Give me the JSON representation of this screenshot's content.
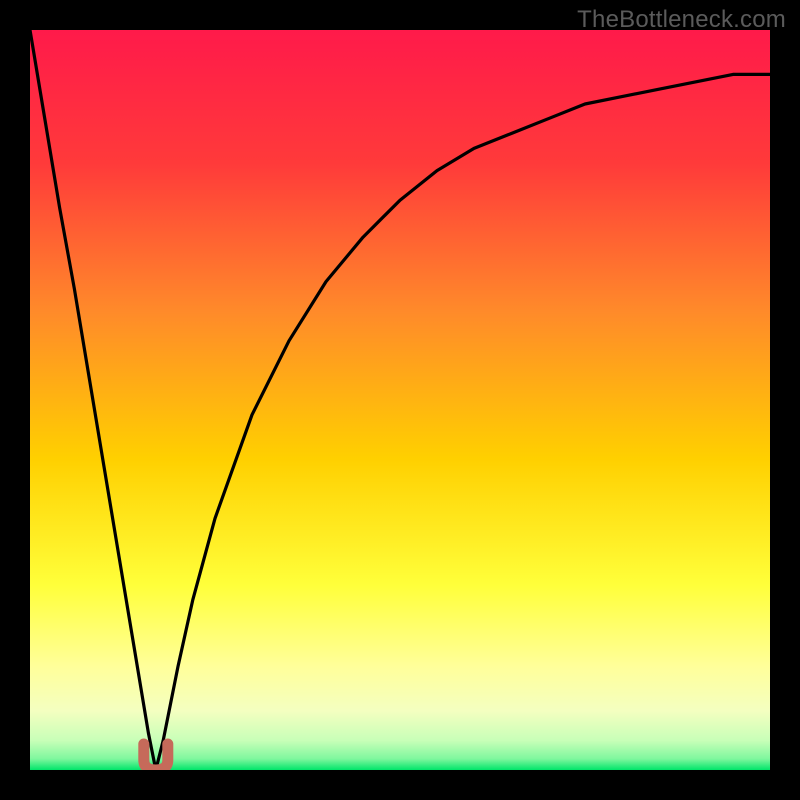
{
  "watermark": "TheBottleneck.com",
  "colors": {
    "frame": "#000000",
    "gradient_top": "#ff1a4a",
    "gradient_mid1": "#ff6a2a",
    "gradient_mid2": "#ffd000",
    "gradient_mid3": "#ffff5a",
    "gradient_mid4": "#eaff9a",
    "gradient_bottom": "#00e56a",
    "curve": "#000000",
    "marker": "#c66a5a"
  },
  "chart_data": {
    "type": "line",
    "title": "",
    "xlabel": "",
    "ylabel": "",
    "xlim": [
      0,
      100
    ],
    "ylim": [
      0,
      100
    ],
    "legend": false,
    "grid": false,
    "axes_visible": false,
    "series": [
      {
        "name": "bottleneck-curve",
        "description": "V-shaped bottleneck curve: bottleneck % vs parameter %. Minimum near x≈17.",
        "x": [
          0,
          2,
          4,
          6,
          8,
          10,
          12,
          14,
          15,
          16,
          17,
          18,
          19,
          20,
          22,
          25,
          30,
          35,
          40,
          45,
          50,
          55,
          60,
          65,
          70,
          75,
          80,
          85,
          90,
          95,
          100
        ],
        "values": [
          100,
          88,
          76,
          65,
          53,
          41,
          29,
          17,
          11,
          5,
          0,
          4,
          9,
          14,
          23,
          34,
          48,
          58,
          66,
          72,
          77,
          81,
          84,
          86,
          88,
          90,
          91,
          92,
          93,
          94,
          94
        ]
      }
    ],
    "annotations": [
      {
        "name": "optimal-point",
        "x": 17,
        "y": 0,
        "shape": "U",
        "color": "#c66a5a"
      }
    ]
  }
}
